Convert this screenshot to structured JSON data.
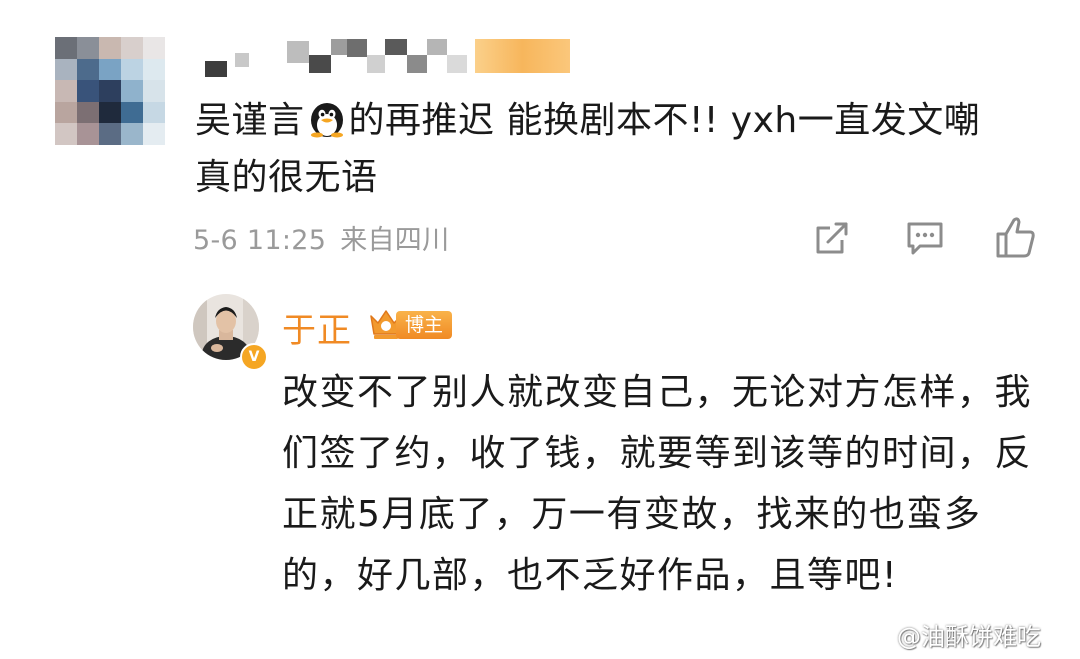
{
  "comment": {
    "avatar": "blurred-avatar",
    "username": "blurred-username",
    "text_before_emoji": "吴谨言",
    "emoji": "penguin-emoji",
    "text_after_emoji": "的再推迟 能换剧本不!! yxh一直发文嘲 真的很无语",
    "date": "5-6 11:25",
    "location": "来自四川",
    "actions": [
      "share-icon",
      "comment-icon",
      "like-icon"
    ]
  },
  "reply": {
    "avatar": "user-avatar",
    "verified_badge": "V",
    "name": "于正",
    "badge_label": "博主",
    "text": "改变不了别人就改变自己，无论对方怎样，我们签了约，收了钱，就要等到该等的时间，反正就5月底了，万一有变故，找来的也蛮多的，好几部，也不乏好作品，且等吧!"
  },
  "watermark": {
    "logo": "weibo-logo",
    "text": "@油酥饼难吃"
  },
  "colors": {
    "accent_orange": "#f08a24",
    "meta_gray": "#9a9a9a",
    "text": "#1a1a1a"
  }
}
